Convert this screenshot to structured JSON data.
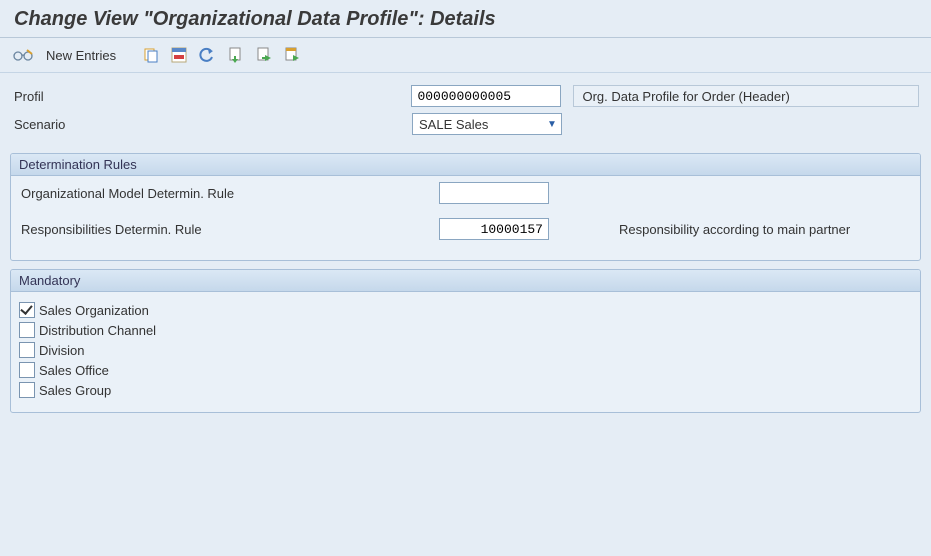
{
  "title": "Change View \"Organizational Data Profile\": Details",
  "toolbar": {
    "new_entries_label": "New Entries"
  },
  "form": {
    "profil_label": "Profil",
    "profil_value": "000000000005",
    "profil_desc": "Org. Data Profile for Order (Header)",
    "scenario_label": "Scenario",
    "scenario_value": "SALE Sales"
  },
  "group1": {
    "title": "Determination Rules",
    "org_model_label": "Organizational Model Determin. Rule",
    "org_model_value": "",
    "resp_label": "Responsibilities Determin. Rule",
    "resp_value": "10000157",
    "resp_desc": "Responsibility according to main partner"
  },
  "group2": {
    "title": "Mandatory",
    "items": [
      {
        "label": "Sales Organization",
        "checked": true
      },
      {
        "label": "Distribution Channel",
        "checked": false
      },
      {
        "label": "Division",
        "checked": false
      },
      {
        "label": "Sales Office",
        "checked": false
      },
      {
        "label": "Sales Group",
        "checked": false
      }
    ]
  }
}
